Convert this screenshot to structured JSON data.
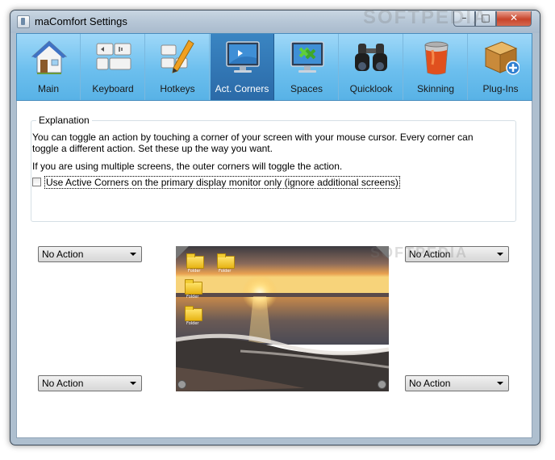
{
  "window": {
    "title": "maComfort Settings",
    "controls": {
      "minimize": "–",
      "maximize": "□",
      "close": "✕"
    }
  },
  "tabs": [
    {
      "label": "Main",
      "icon": "house-icon",
      "active": false
    },
    {
      "label": "Keyboard",
      "icon": "keyboard-icon",
      "active": false
    },
    {
      "label": "Hotkeys",
      "icon": "hotkeys-icon",
      "active": false
    },
    {
      "label": "Act. Corners",
      "icon": "monitor-corners-icon",
      "active": true
    },
    {
      "label": "Spaces",
      "icon": "spaces-icon",
      "active": false
    },
    {
      "label": "Quicklook",
      "icon": "binoculars-icon",
      "active": false
    },
    {
      "label": "Skinning",
      "icon": "paint-bucket-icon",
      "active": false
    },
    {
      "label": "Plug-Ins",
      "icon": "plugin-box-icon",
      "active": false
    }
  ],
  "explanation": {
    "title": "Explanation",
    "text1": "You can toggle an action by touching a corner of your screen with your mouse cursor. Every corner can toggle a different action. Set these up the way you want.",
    "text2": "If you are using multiple screens, the outer corners will toggle the action.",
    "checkbox_label": "Use Active Corners on the primary display monitor only (ignore additional screens)",
    "checkbox_checked": false
  },
  "corners": {
    "top_left": "No Action",
    "top_right": "No Action",
    "bottom_left": "No Action",
    "bottom_right": "No Action"
  },
  "preview": {
    "folder_labels": [
      "Folder",
      "Folder",
      "Folder",
      "Folder"
    ]
  },
  "watermark": "SOFTPEDIA",
  "colors": {
    "toolbar_top": "#9fd8f8",
    "toolbar_bottom": "#58b2e6",
    "active_tab": "#2b6aa8",
    "close_button": "#c8442b"
  }
}
